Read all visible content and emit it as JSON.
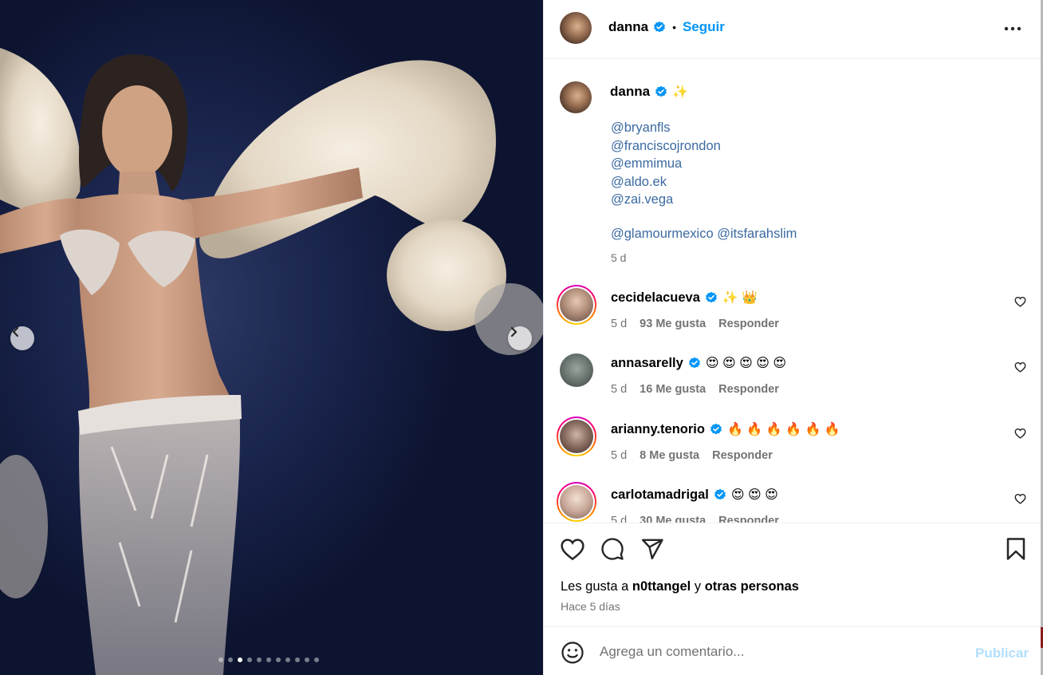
{
  "media": {
    "total_slides": 11,
    "active_slide": 3,
    "prev_icon": "chevron-left-icon",
    "next_icon": "chevron-right-icon"
  },
  "header": {
    "username": "danna",
    "separator": "•",
    "follow_label": "Seguir",
    "more_icon": "more-horizontal-icon"
  },
  "caption": {
    "username": "danna",
    "emoji": "✨",
    "mentions": [
      "@bryanfls",
      "@franciscojrondon",
      "@emmimua",
      "@aldo.ek",
      "@zai.vega"
    ],
    "extra_mentions": [
      "@glamourmexico",
      "@itsfarahslim"
    ],
    "time": "5 d"
  },
  "comments": [
    {
      "username": "cecidelacueva",
      "text": "✨ 👑",
      "time": "5 d",
      "likes": "93 Me gusta",
      "reply": "Responder",
      "story_ring": true
    },
    {
      "username": "annasarelly",
      "text": "😍 😍 😍 😍 😍",
      "time": "5 d",
      "likes": "16 Me gusta",
      "reply": "Responder",
      "story_ring": false
    },
    {
      "username": "arianny.tenorio",
      "text": "🔥 🔥 🔥 🔥 🔥 🔥",
      "time": "5 d",
      "likes": "8 Me gusta",
      "reply": "Responder",
      "story_ring": true
    },
    {
      "username": "carlotamadrigal",
      "text": "😍 😍 😍",
      "time": "5 d",
      "likes": "30 Me gusta",
      "reply": "Responder",
      "story_ring": true
    }
  ],
  "actions": {
    "likes_prefix": "Les gusta a",
    "likes_user": "n0ttangel",
    "likes_join": "y",
    "likes_others": "otras personas",
    "date": "Hace 5 días"
  },
  "composer": {
    "placeholder": "Agrega un comentario...",
    "publish_label": "Publicar"
  },
  "colors": {
    "link": "#0095f6",
    "mention": "#3b6aa0",
    "muted": "#737373",
    "verified": "#0095f6",
    "publish_disabled": "#b2dffc"
  }
}
